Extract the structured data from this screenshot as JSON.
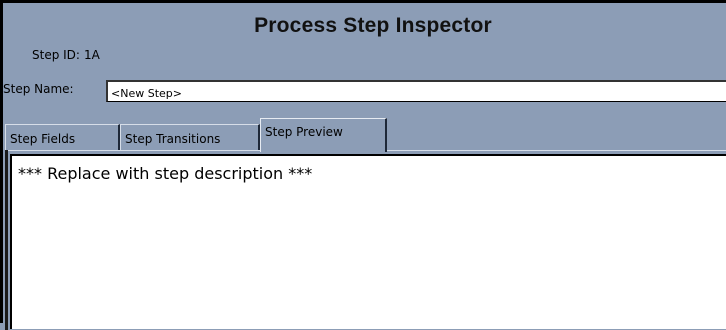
{
  "window": {
    "title": "Process Step Inspector"
  },
  "step": {
    "id_label": "Step ID:",
    "id_value": "1A",
    "name_label": "Step Name:",
    "name_value": "<New Step>"
  },
  "tabs": [
    {
      "label": "Step Fields",
      "active": false
    },
    {
      "label": "Step Transitions",
      "active": false
    },
    {
      "label": "Step Preview",
      "active": true
    }
  ],
  "preview": {
    "text": "*** Replace with step description ***"
  },
  "colors": {
    "panel_background": "#8c9db6",
    "content_background": "#ffffff"
  }
}
